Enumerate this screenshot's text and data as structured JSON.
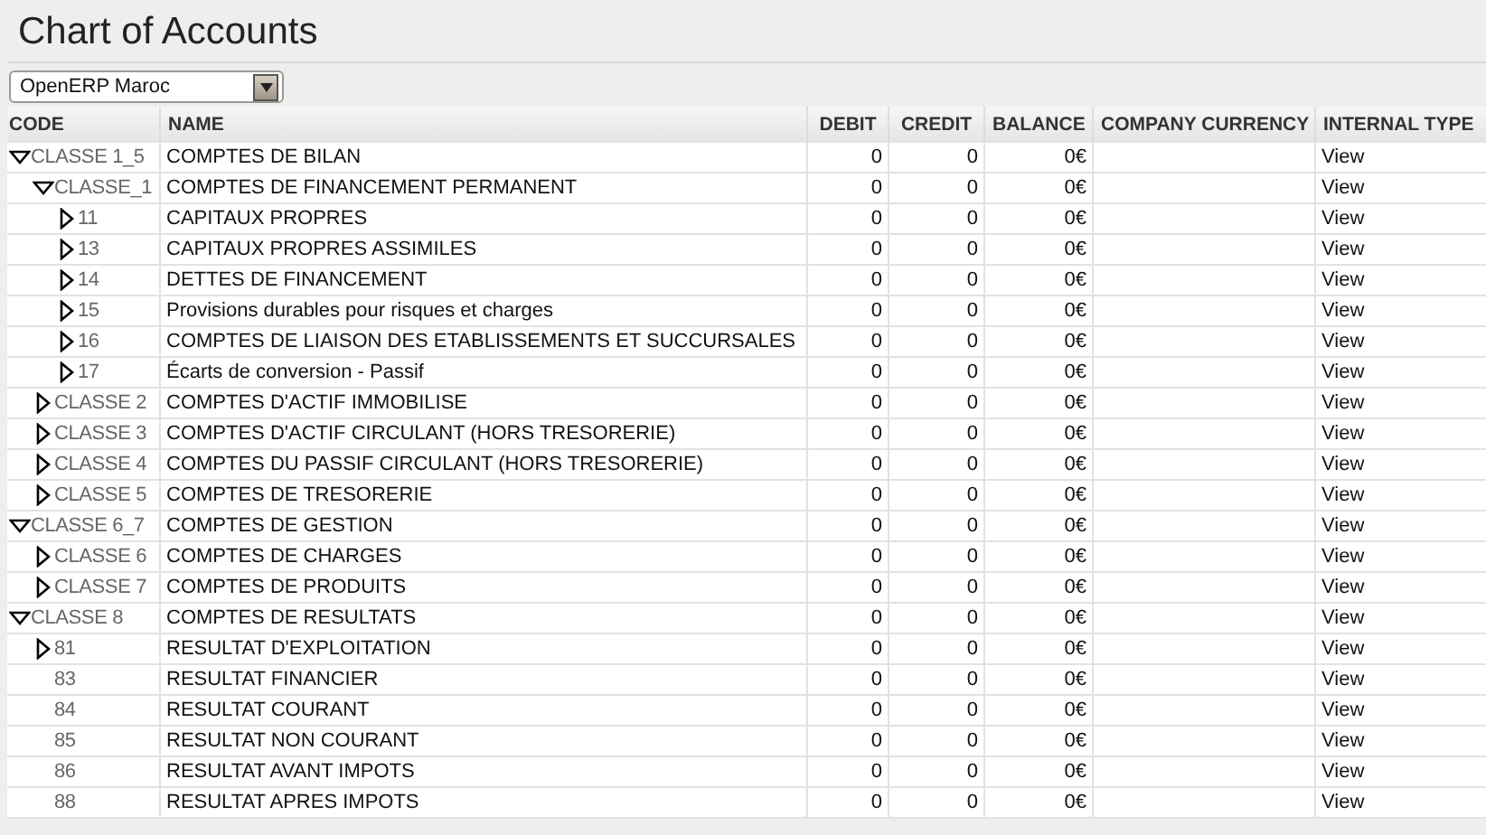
{
  "title": "Chart of Accounts",
  "company_select": {
    "value": "OpenERP Maroc"
  },
  "table": {
    "columns": [
      "CODE",
      "NAME",
      "DEBIT",
      "CREDIT",
      "BALANCE",
      "COMPANY CURRENCY",
      "INTERNAL TYPE"
    ],
    "rows": [
      {
        "kind": "group",
        "expanded": true,
        "code": "CLASSE 1_5",
        "name": "COMPTES DE BILAN",
        "debit": "0",
        "credit": "0",
        "balance": "0€",
        "internal_type": "View",
        "children": [
          {
            "kind": "group",
            "expanded": true,
            "code": "CLASSE_1",
            "name": "COMPTES DE FINANCEMENT PERMANENT",
            "debit": "0",
            "credit": "0",
            "balance": "0€",
            "internal_type": "View",
            "children": [
              {
                "kind": "group",
                "expanded": false,
                "code": "11",
                "name": "CAPITAUX PROPRES",
                "debit": "0",
                "credit": "0",
                "balance": "0€",
                "internal_type": "View"
              },
              {
                "kind": "group",
                "expanded": false,
                "code": "13",
                "name": "CAPITAUX PROPRES ASSIMILES",
                "debit": "0",
                "credit": "0",
                "balance": "0€",
                "internal_type": "View"
              },
              {
                "kind": "group",
                "expanded": false,
                "code": "14",
                "name": "DETTES DE FINANCEMENT",
                "debit": "0",
                "credit": "0",
                "balance": "0€",
                "internal_type": "View"
              },
              {
                "kind": "group",
                "expanded": false,
                "code": "15",
                "name": "Provisions durables pour risques et charges",
                "debit": "0",
                "credit": "0",
                "balance": "0€",
                "internal_type": "View"
              },
              {
                "kind": "group",
                "expanded": false,
                "code": "16",
                "name": "COMPTES DE LIAISON DES ETABLISSEMENTS ET SUCCURSALES",
                "debit": "0",
                "credit": "0",
                "balance": "0€",
                "internal_type": "View"
              },
              {
                "kind": "group",
                "expanded": false,
                "code": "17",
                "name": "Écarts de conversion - Passif",
                "debit": "0",
                "credit": "0",
                "balance": "0€",
                "internal_type": "View"
              }
            ]
          },
          {
            "kind": "group",
            "expanded": false,
            "code": "CLASSE 2",
            "name": "COMPTES D'ACTIF IMMOBILISE",
            "debit": "0",
            "credit": "0",
            "balance": "0€",
            "internal_type": "View"
          },
          {
            "kind": "group",
            "expanded": false,
            "code": "CLASSE 3",
            "name": "COMPTES D'ACTIF CIRCULANT (HORS TRESORERIE)",
            "debit": "0",
            "credit": "0",
            "balance": "0€",
            "internal_type": "View"
          },
          {
            "kind": "group",
            "expanded": false,
            "code": "CLASSE 4",
            "name": "COMPTES DU PASSIF CIRCULANT (HORS TRESORERIE)",
            "debit": "0",
            "credit": "0",
            "balance": "0€",
            "internal_type": "View"
          },
          {
            "kind": "group",
            "expanded": false,
            "code": "CLASSE 5",
            "name": "COMPTES DE TRESORERIE",
            "debit": "0",
            "credit": "0",
            "balance": "0€",
            "internal_type": "View"
          }
        ]
      },
      {
        "kind": "group",
        "expanded": true,
        "code": "CLASSE 6_7",
        "name": "COMPTES DE GESTION",
        "debit": "0",
        "credit": "0",
        "balance": "0€",
        "internal_type": "View",
        "children": [
          {
            "kind": "group",
            "expanded": false,
            "code": "CLASSE 6",
            "name": "COMPTES DE CHARGES",
            "debit": "0",
            "credit": "0",
            "balance": "0€",
            "internal_type": "View"
          },
          {
            "kind": "group",
            "expanded": false,
            "code": "CLASSE 7",
            "name": "COMPTES DE PRODUITS",
            "debit": "0",
            "credit": "0",
            "balance": "0€",
            "internal_type": "View"
          }
        ]
      },
      {
        "kind": "group",
        "expanded": true,
        "code": "CLASSE 8",
        "name": "COMPTES DE RESULTATS",
        "debit": "0",
        "credit": "0",
        "balance": "0€",
        "internal_type": "View",
        "children": [
          {
            "kind": "group",
            "expanded": false,
            "code": "81",
            "name": "RESULTAT D'EXPLOITATION",
            "debit": "0",
            "credit": "0",
            "balance": "0€",
            "internal_type": "View"
          },
          {
            "kind": "leaf",
            "code": "83",
            "name": "RESULTAT FINANCIER",
            "debit": "0",
            "credit": "0",
            "balance": "0€",
            "internal_type": "View"
          },
          {
            "kind": "leaf",
            "code": "84",
            "name": "RESULTAT COURANT",
            "debit": "0",
            "credit": "0",
            "balance": "0€",
            "internal_type": "View"
          },
          {
            "kind": "leaf",
            "code": "85",
            "name": "RESULTAT NON COURANT",
            "debit": "0",
            "credit": "0",
            "balance": "0€",
            "internal_type": "View"
          },
          {
            "kind": "leaf",
            "code": "86",
            "name": "RESULTAT AVANT IMPOTS",
            "debit": "0",
            "credit": "0",
            "balance": "0€",
            "internal_type": "View"
          },
          {
            "kind": "leaf",
            "code": "88",
            "name": "RESULTAT APRES IMPOTS",
            "debit": "0",
            "credit": "0",
            "balance": "0€",
            "internal_type": "View"
          }
        ]
      }
    ]
  }
}
